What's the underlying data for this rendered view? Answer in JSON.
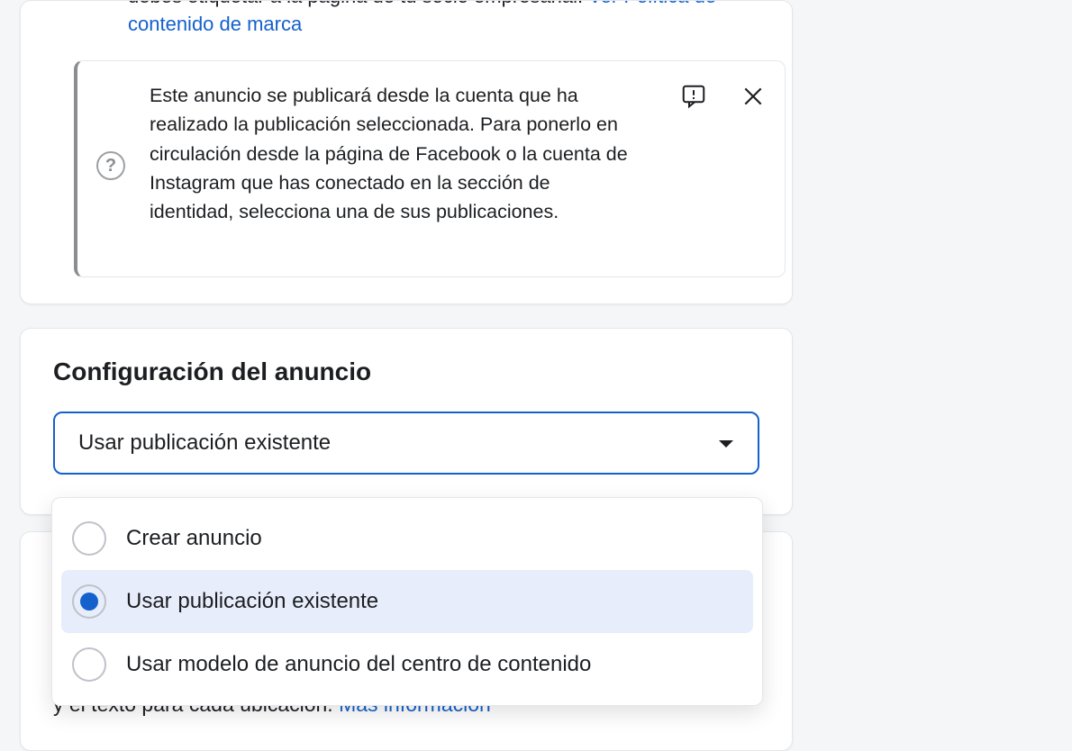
{
  "top": {
    "brand_label_prefix": "debes etiquetar a la página de tu socio empresarial. ",
    "brand_link": "Ver Política de contenido de marca",
    "info_text": "Este anuncio se publicará desde la cuenta que ha realizado la publicación seleccionada. Para ponerlo en circulación desde la página de Facebook o la cuenta de Instagram que has conectado en la sección de identidad, selecciona una de sus publicaciones."
  },
  "config": {
    "title": "Configuración del anuncio",
    "selected_label": "Usar publicación existente",
    "options": [
      {
        "label": "Crear anuncio",
        "selected": false
      },
      {
        "label": "Usar publicación existente",
        "selected": true
      },
      {
        "label": "Usar modelo de anuncio del centro de contenido",
        "selected": false
      }
    ]
  },
  "lower": {
    "text_before_link": "y el texto para cada ubicación. ",
    "link": "Más información"
  }
}
